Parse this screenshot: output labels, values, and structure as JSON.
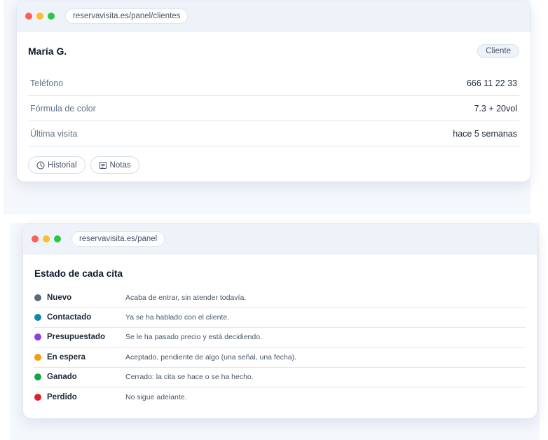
{
  "client_window": {
    "url": "reservavisita.es/panel/clientes",
    "name": "María G.",
    "badge": "Cliente",
    "rows": [
      {
        "label": "Teléfono",
        "value": "666 11 22 33"
      },
      {
        "label": "Fórmula de color",
        "value": "7.3 + 20vol"
      },
      {
        "label": "Última visita",
        "value": "hace 5 semanas"
      }
    ],
    "actions": [
      {
        "label": "Historial",
        "icon": "clock-icon"
      },
      {
        "label": "Notas",
        "icon": "note-icon"
      }
    ]
  },
  "status_window": {
    "url": "reservavisita.es/panel",
    "title": "Estado de cada cita",
    "statuses": [
      {
        "name": "Nuevo",
        "description": "Acaba de entrar, sin atender todavía.",
        "color": "#5b6b7d"
      },
      {
        "name": "Contactado",
        "description": "Ya se ha hablado con el cliente.",
        "color": "#0e8aa4"
      },
      {
        "name": "Presupuestado",
        "description": "Se le ha pasado precio y está decidiendo.",
        "color": "#8b3fe8"
      },
      {
        "name": "En espera",
        "description": "Aceptado, pendiente de algo (una señal, una fecha).",
        "color": "#f59e0b"
      },
      {
        "name": "Ganado",
        "description": "Cerrado: la cita se hace o se ha hecho.",
        "color": "#16a34a"
      },
      {
        "name": "Perdido",
        "description": "No sigue adelante.",
        "color": "#e11d2e"
      }
    ]
  }
}
